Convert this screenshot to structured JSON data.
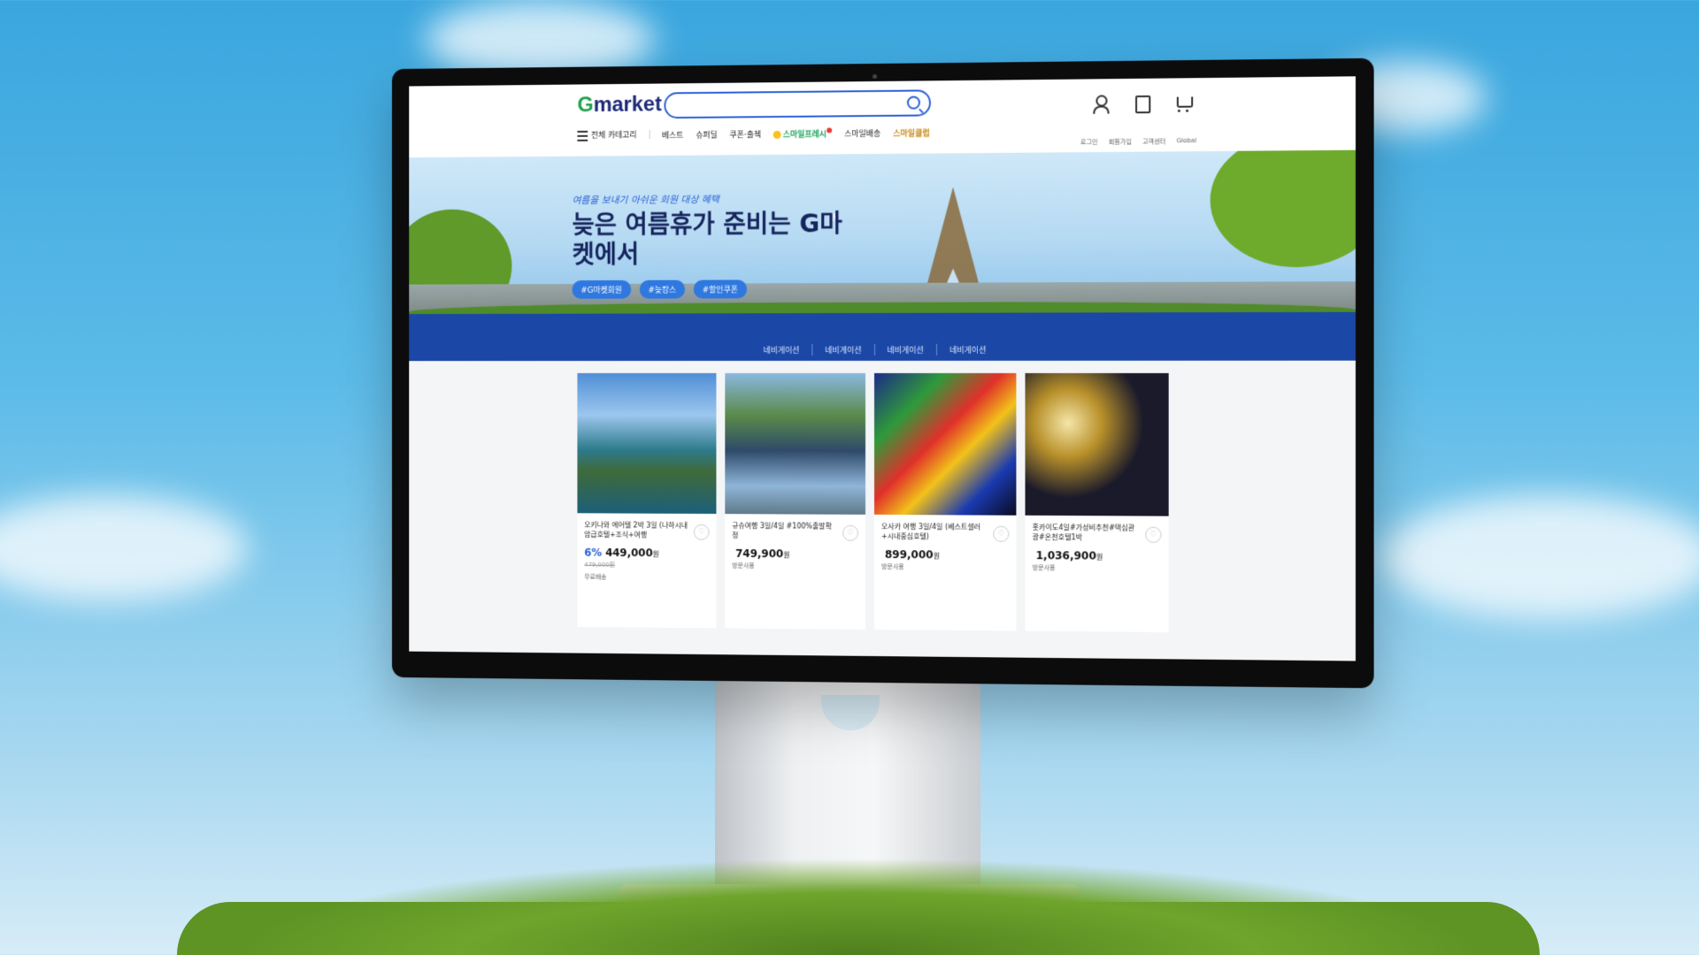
{
  "header": {
    "logo_g": "G",
    "logo_rest": "market",
    "search_placeholder": "",
    "nav": {
      "all_categories": "전체 카테고리",
      "best": "베스트",
      "super": "슈퍼딜",
      "coupon": "쿠폰·출첵",
      "smile_fresh": "스마일프레시",
      "smile_delivery": "스마일배송",
      "smile_club": "스마일클럽"
    },
    "util": [
      "로그인",
      "회원가입",
      "고객센터",
      "Global"
    ]
  },
  "banner": {
    "subtitle": "여름을 보내기 아쉬운 회원 대상 혜택",
    "title": "늦은 여름휴가 준비는 G마켓에서",
    "tags": [
      "#G마켓회원",
      "#늦캉스",
      "#할인쿠폰"
    ]
  },
  "subnav": [
    "네비게이션",
    "네비게이션",
    "네비게이션",
    "네비게이션"
  ],
  "products": [
    {
      "name": "오키나와 에어텔 2박 3일 (나하시내암급호텔+조식+여행",
      "discount": "6%",
      "price": "449,000",
      "currency": "원",
      "old_price": "479,000원",
      "note": "무료배송"
    },
    {
      "name": "규슈여행 3일/4일 #100%출발확정",
      "discount": "",
      "price": "749,900",
      "currency": "원",
      "old_price": "",
      "note": "방문사용"
    },
    {
      "name": "오사카 여행 3일/4일 (베스트셀러+시내중심호텔)",
      "discount": "",
      "price": "899,000",
      "currency": "원",
      "old_price": "",
      "note": "방문사용"
    },
    {
      "name": "홋카이도4일#가성비추천#택심관광#온천호텔1박",
      "discount": "",
      "price": "1,036,900",
      "currency": "원",
      "old_price": "",
      "note": "방문사용"
    }
  ]
}
